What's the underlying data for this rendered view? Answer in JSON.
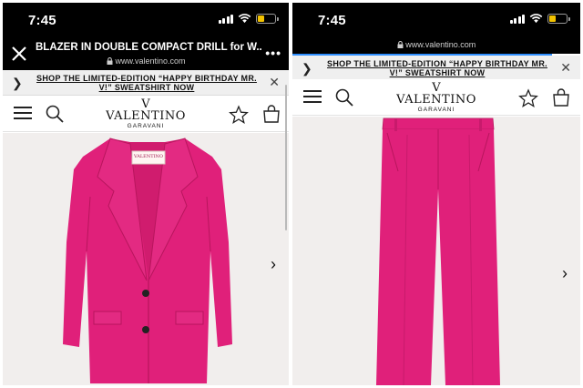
{
  "left": {
    "status": {
      "time": "7:45"
    },
    "browser": {
      "title": "BLAZER IN DOUBLE COMPACT DRILL for W...",
      "url": "www.valentino.com",
      "more_label": "•••"
    },
    "promo": {
      "text": "SHOP THE LIMITED-EDITION “HAPPY BIRTHDAY MR. V!” SWEATSHIRT NOW"
    },
    "logo": {
      "mark": "V",
      "name": "VALENTINO",
      "sub": "GARAVANI"
    },
    "product": {
      "label_tag": "VALENTINO",
      "color": "#e0207a"
    }
  },
  "right": {
    "status": {
      "time": "7:45"
    },
    "browser": {
      "url": "www.valentino.com"
    },
    "promo": {
      "text": "SHOP THE LIMITED-EDITION “HAPPY BIRTHDAY MR. V!” SWEATSHIRT NOW"
    },
    "logo": {
      "mark": "V",
      "name": "VALENTINO",
      "sub": "GARAVANI"
    },
    "product": {
      "color": "#e0207a"
    }
  },
  "icons": {
    "close": "close-icon",
    "lock": "lock-icon",
    "more": "more-icon",
    "chevron": "chevron-right-icon",
    "menu": "hamburger-menu-icon",
    "search": "search-icon",
    "wishlist": "star-icon",
    "bag": "shopping-bag-icon"
  },
  "colors": {
    "accent_pink": "#e0207a",
    "progress_blue": "#2f8fff",
    "battery": "#f2c200"
  }
}
